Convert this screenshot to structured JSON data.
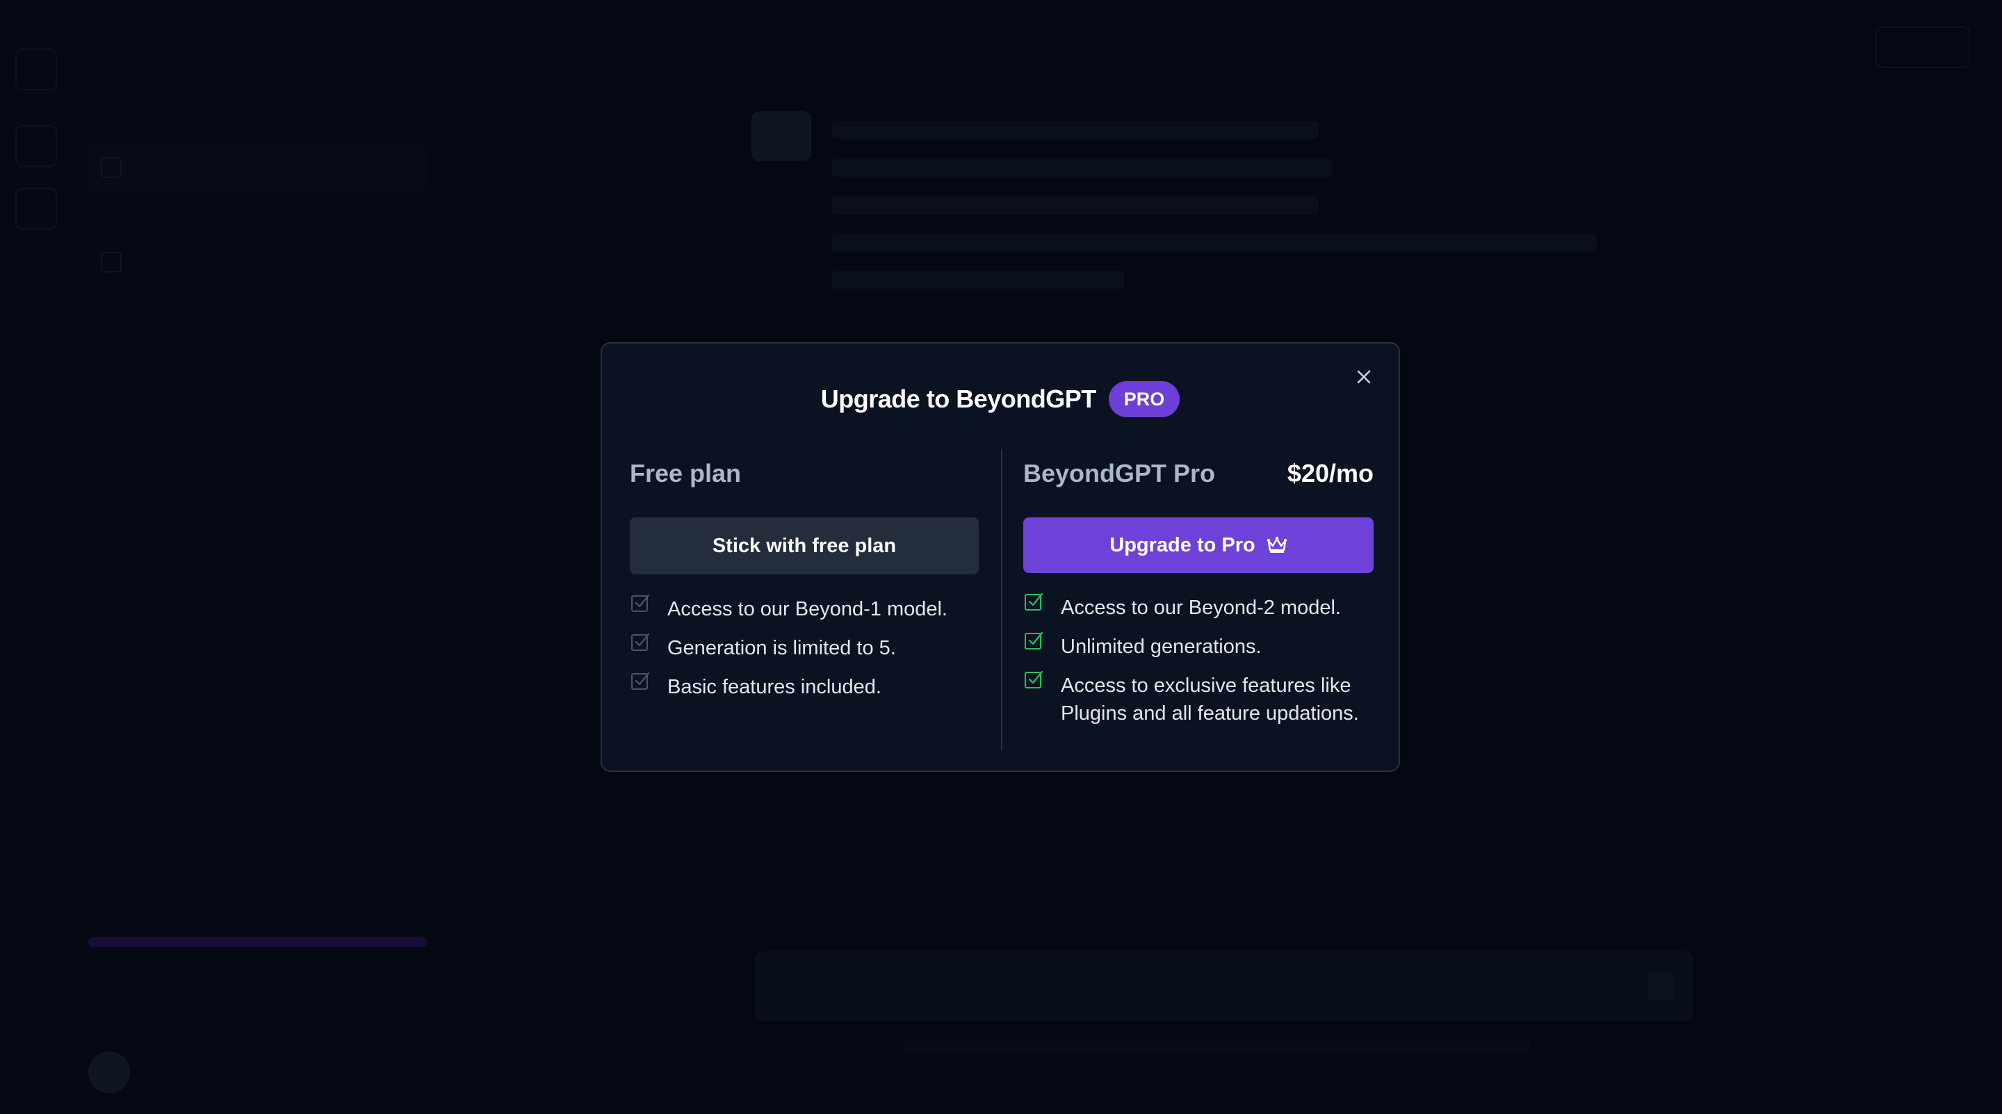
{
  "modal": {
    "title": "Upgrade to BeyondGPT",
    "badge": "PRO",
    "free_plan": {
      "name": "Free plan",
      "button_label": "Stick with free plan",
      "features": [
        "Access to our Beyond-1 model.",
        "Generation is limited to 5.",
        "Basic features included."
      ]
    },
    "pro_plan": {
      "name": "BeyondGPT Pro",
      "price": "$20/mo",
      "button_label": "Upgrade to Pro",
      "button_icon": "crown-icon",
      "features": [
        "Access to our Beyond-2 model.",
        "Unlimited generations.",
        "Access to exclusive features like Plugins and all feature updations."
      ]
    },
    "close_icon": "close-icon"
  },
  "colors": {
    "accent": "#6e41d8",
    "check_free": "#4b5563",
    "check_pro": "#22c55e",
    "modal_bg": "#0b1221"
  }
}
